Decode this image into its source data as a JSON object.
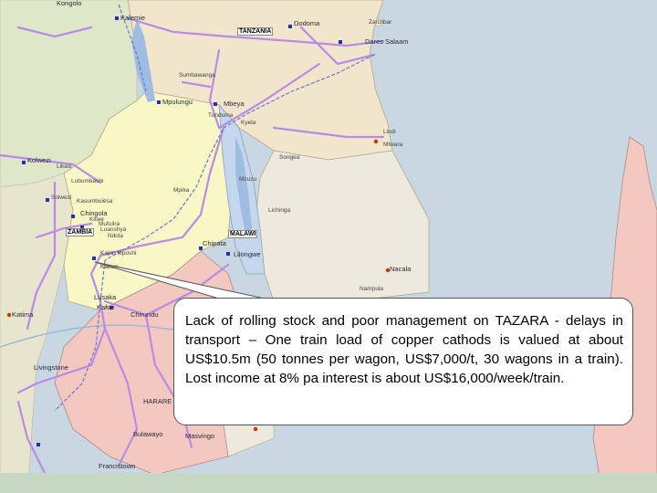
{
  "map": {
    "colors": {
      "ocean": "#c9d7e2",
      "land_tanzania": "#f1e6cc",
      "land_zambia": "#f9f7c5",
      "land_malawi": "#c4d7ec",
      "land_mozambique": "#ede9de",
      "land_zimbabwe": "#f2c8c0",
      "land_west": "#dfe7c9",
      "roads": "#b98be6",
      "railways": "#6a78c9",
      "lake": "#9fbde0",
      "callout_border": "#555555",
      "bottom_bar": "#c5d8c3"
    },
    "places": [
      {
        "id": "kongolo",
        "text": "Kongolo"
      },
      {
        "id": "kalemie",
        "text": "Kalemie"
      },
      {
        "id": "dodoma",
        "text": "Dodoma"
      },
      {
        "id": "zanzibar",
        "text": "Zanzibar"
      },
      {
        "id": "daressalaam",
        "text": "Dares Salaam"
      },
      {
        "id": "sumbawanga",
        "text": "Sumbawanga"
      },
      {
        "id": "mpulungu",
        "text": "Mpulungu"
      },
      {
        "id": "mbeya",
        "text": "Mbeya"
      },
      {
        "id": "tunduma",
        "text": "Tunduma"
      },
      {
        "id": "kyela",
        "text": "Kyela"
      },
      {
        "id": "lindi",
        "text": "Lindi"
      },
      {
        "id": "mtwara",
        "text": "Mtwara"
      },
      {
        "id": "songea",
        "text": "Songea"
      },
      {
        "id": "kolwezi",
        "text": "Kolwezi"
      },
      {
        "id": "likasi",
        "text": "Likasi"
      },
      {
        "id": "lubumbashi",
        "text": "Lubumbashi"
      },
      {
        "id": "mpika",
        "text": "Mpika"
      },
      {
        "id": "mzuzu",
        "text": "Mzuzu"
      },
      {
        "id": "solwezi",
        "text": "Solwezi"
      },
      {
        "id": "kasumbulesa",
        "text": "Kasumbulesa"
      },
      {
        "id": "chingola",
        "text": "Chingola"
      },
      {
        "id": "kitwe",
        "text": "Kitwe"
      },
      {
        "id": "mufulira",
        "text": "Mufulira"
      },
      {
        "id": "luanshya",
        "text": "Luanshya"
      },
      {
        "id": "ndola",
        "text": "Ndola"
      },
      {
        "id": "lichinga",
        "text": "Lichinga"
      },
      {
        "id": "kapirimposhi",
        "text": "Kapiri Mposhi"
      },
      {
        "id": "chipata",
        "text": "Chipata"
      },
      {
        "id": "lilongwe",
        "text": "Lilongwe"
      },
      {
        "id": "nacala",
        "text": "Nacala"
      },
      {
        "id": "nampula",
        "text": "Nampula"
      },
      {
        "id": "kabwe",
        "text": "Kabwe"
      },
      {
        "id": "lusaka",
        "text": "Lusaka"
      },
      {
        "id": "kafue",
        "text": "Kafue"
      },
      {
        "id": "chirundu",
        "text": "Chirundu"
      },
      {
        "id": "katima",
        "text": "Katima"
      },
      {
        "id": "livingstone",
        "text": "Livingstone"
      },
      {
        "id": "harare",
        "text": "HARARE"
      },
      {
        "id": "masvingo",
        "text": "Masvingo"
      },
      {
        "id": "bulawayo",
        "text": "Bulawayo"
      },
      {
        "id": "francistown",
        "text": "Francistown"
      }
    ],
    "countries": [
      {
        "id": "tanzania",
        "text": "TANZANIA"
      },
      {
        "id": "zambia",
        "text": "ZAMBIA"
      },
      {
        "id": "malawi",
        "text": "MALAWI"
      }
    ]
  },
  "callout": {
    "text": "Lack of rolling stock and poor management on TAZARA - delays in transport – One train load of copper cathods is valued at about US$10.5m (50 tonnes per wagon, US$7,000/t, 30 wagons in a train). Lost income at 8% pa interest is about US$16,000/week/train."
  }
}
